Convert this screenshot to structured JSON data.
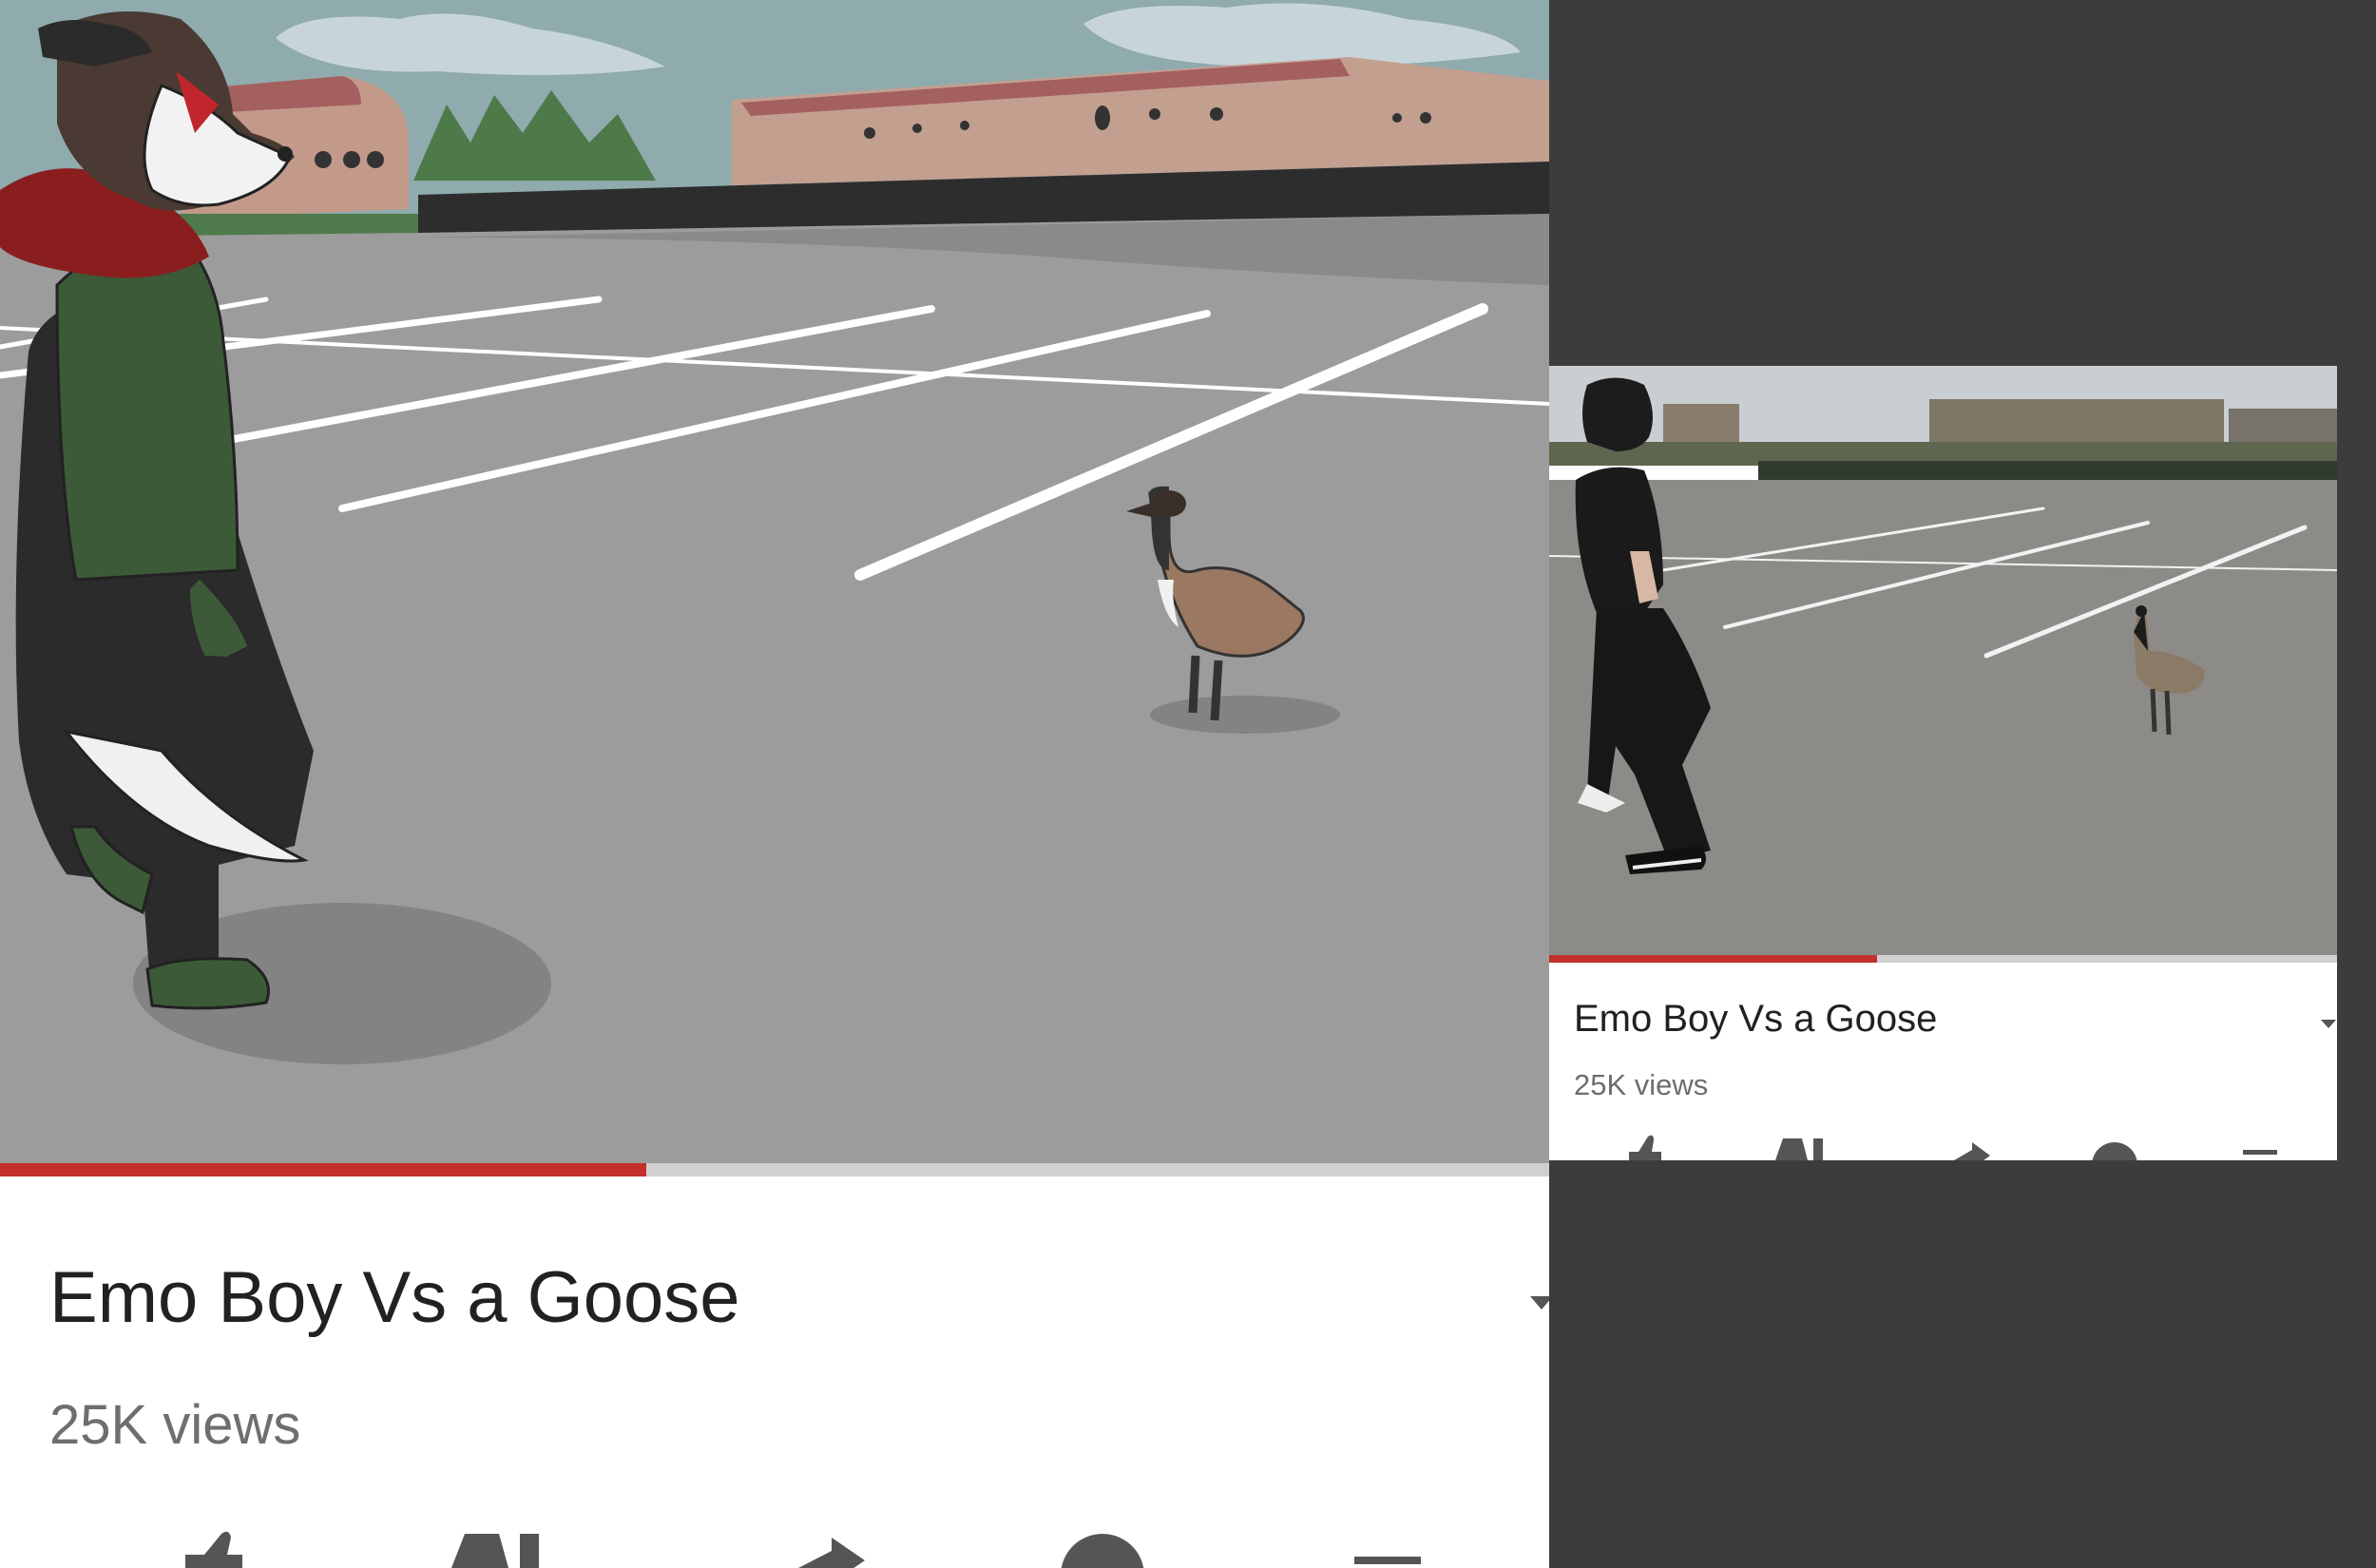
{
  "layout_pieces": {
    "left_panel": {
      "scene": "illustrated cartoon of a dog character facing a goose in a parking lot",
      "video_title": "Emo Boy Vs a Goose",
      "view_count": "25K views"
    },
    "right_panel": {
      "scene": "photo of a boy in black walking toward a Canada goose in a parking lot",
      "video_title": "Emo Boy Vs a Goose",
      "view_count": "25K views"
    }
  },
  "icons": [
    "like-icon",
    "dislike-icon",
    "share-icon",
    "download-icon",
    "save-icon",
    "expand-chevron-icon"
  ],
  "colors": {
    "progress_played": "#c4302b",
    "progress_track": "#d0d0d0",
    "background": "#3c3c3c",
    "title_text": "#212121",
    "views_text": "#6e6e6e"
  }
}
